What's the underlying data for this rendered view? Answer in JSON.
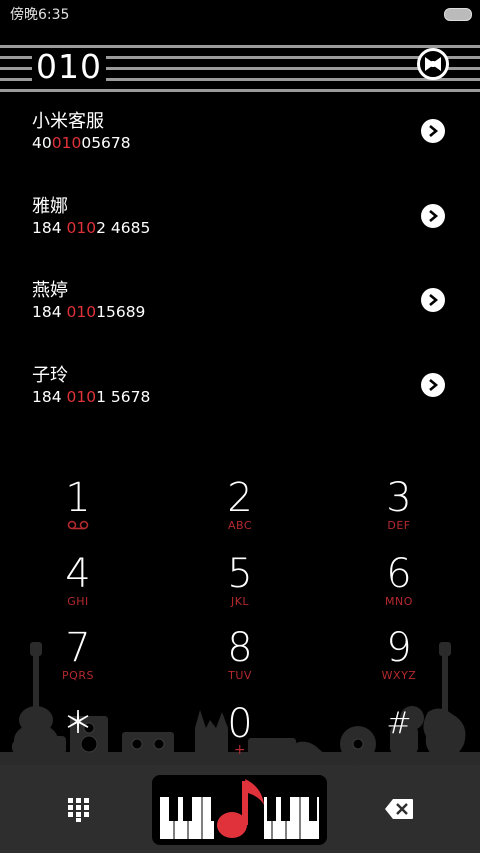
{
  "status_bar": {
    "time": "傍晚6:35"
  },
  "search": {
    "query": "010"
  },
  "results": [
    {
      "name": "小米客服",
      "phone_pre": "40",
      "phone_match": "010",
      "phone_post": "05678"
    },
    {
      "name": "雅娜",
      "phone_pre": "184 ",
      "phone_match": "010",
      "phone_post": "2 4685"
    },
    {
      "name": "燕婷",
      "phone_pre": "184 ",
      "phone_match": "010",
      "phone_post": "15689"
    },
    {
      "name": "子玲",
      "phone_pre": "184 ",
      "phone_match": "010",
      "phone_post": "1 5678"
    }
  ],
  "dialpad": {
    "keys": [
      {
        "digit": "1",
        "sub": "voicemail-icon"
      },
      {
        "digit": "2",
        "sub": "ABC"
      },
      {
        "digit": "3",
        "sub": "DEF"
      },
      {
        "digit": "4",
        "sub": "GHI"
      },
      {
        "digit": "5",
        "sub": "JKL"
      },
      {
        "digit": "6",
        "sub": "MNO"
      },
      {
        "digit": "7",
        "sub": "PQRS"
      },
      {
        "digit": "8",
        "sub": "TUV"
      },
      {
        "digit": "9",
        "sub": "WXYZ"
      },
      {
        "digit": "＊",
        "sub": ""
      },
      {
        "digit": "0",
        "sub": "+"
      },
      {
        "digit": "#",
        "sub": ""
      }
    ]
  },
  "colors": {
    "background": "#000000",
    "accent": "#e0323a",
    "bottom_bar": "#2e2e2e"
  },
  "icons": {
    "header": "bow-tie-icon",
    "contact_action": "chevron-right-icon",
    "bottom_left": "dialpad-grid-icon",
    "call": "music-note-piano-icon",
    "bottom_right": "backspace-icon"
  }
}
